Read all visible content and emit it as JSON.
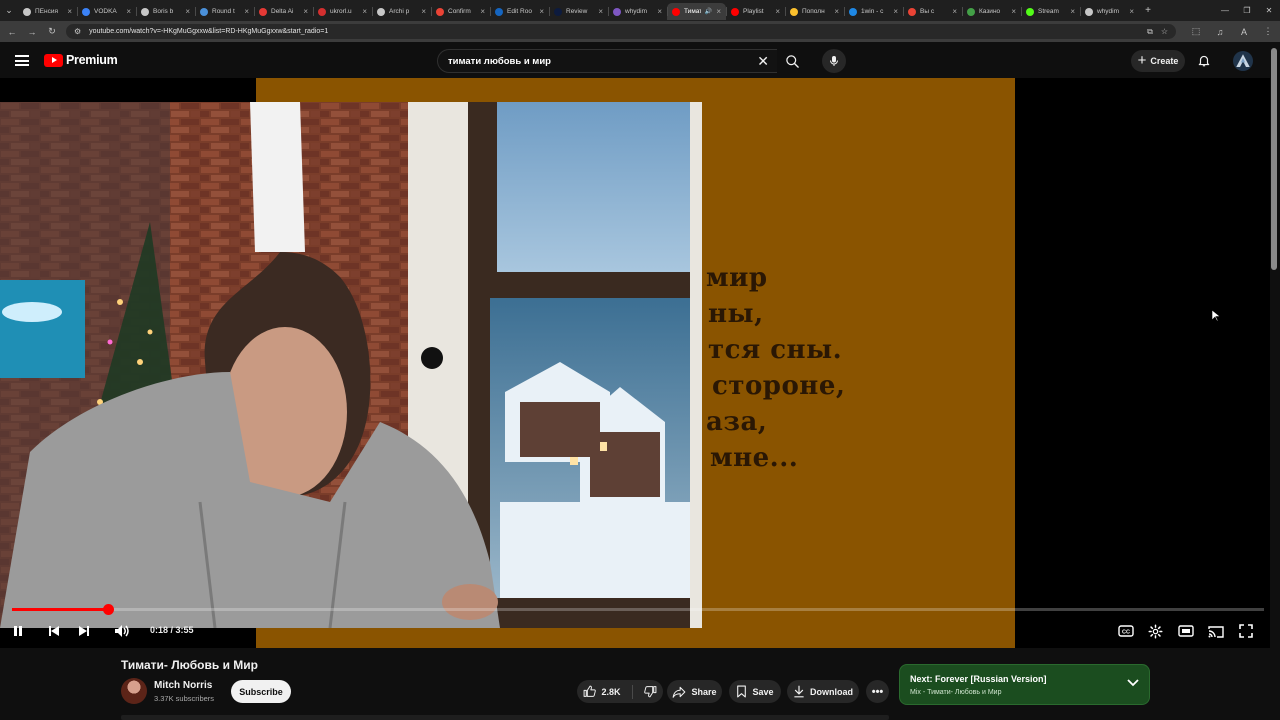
{
  "browser": {
    "tabs": [
      {
        "title": "ПЕнсия",
        "color": "#c7c7c7"
      },
      {
        "title": "VODKA",
        "color": "#3b82f6"
      },
      {
        "title": "Boris b",
        "color": "#c7c7c7"
      },
      {
        "title": "Round t",
        "color": "#4a90d9"
      },
      {
        "title": "Delta Ai",
        "color": "#e53935"
      },
      {
        "title": "ukrorl.u",
        "color": "#d32f2f"
      },
      {
        "title": "Archi p",
        "color": "#c7c7c7"
      },
      {
        "title": "Confirm",
        "color": "#ea4335"
      },
      {
        "title": "Edit Roo",
        "color": "#1565c0"
      },
      {
        "title": "Review",
        "color": "#0d1b3e"
      },
      {
        "title": "whydim",
        "color": "#7e57c2"
      },
      {
        "title": "Тимат",
        "color": "#ff0000",
        "active": true,
        "audio": true
      },
      {
        "title": "Playlist",
        "color": "#ff0000"
      },
      {
        "title": "Пополн",
        "color": "#fbc02d"
      },
      {
        "title": "1win - c",
        "color": "#1e88e5"
      },
      {
        "title": "Вы с",
        "color": "#ea4335"
      },
      {
        "title": "Казино",
        "color": "#43a047"
      },
      {
        "title": "Stream",
        "color": "#53fc18"
      },
      {
        "title": "whydim",
        "color": "#c7c7c7"
      }
    ],
    "url": "youtube.com/watch?v=-HKgMuGgxxw&list=RD-HKgMuGgxxw&start_radio=1"
  },
  "header": {
    "logo_text": "Premium",
    "search_value": "тимати любовь и мир",
    "create_label": "Create"
  },
  "player": {
    "lyrics": [
      "мир",
      "ны,",
      "тся сны.",
      "стороне,",
      "аза,",
      "мне..."
    ],
    "time": "0:18 / 3:55",
    "progress": 0.077
  },
  "video": {
    "title": "Тимати- Любовь и Мир",
    "channel": "Mitch Norris",
    "subscribers": "3.37K subscribers",
    "subscribe_label": "Subscribe",
    "likes": "2.8K",
    "share_label": "Share",
    "save_label": "Save",
    "download_label": "Download"
  },
  "next": {
    "title": "Next: Forever [Russian Version]",
    "subtitle": "Mix - Тимати- Любовь и Мир"
  },
  "colors": {
    "lyrics_bg": "#8a5400",
    "accent": "#ff0000",
    "next_bg": "#1b4d1f"
  }
}
